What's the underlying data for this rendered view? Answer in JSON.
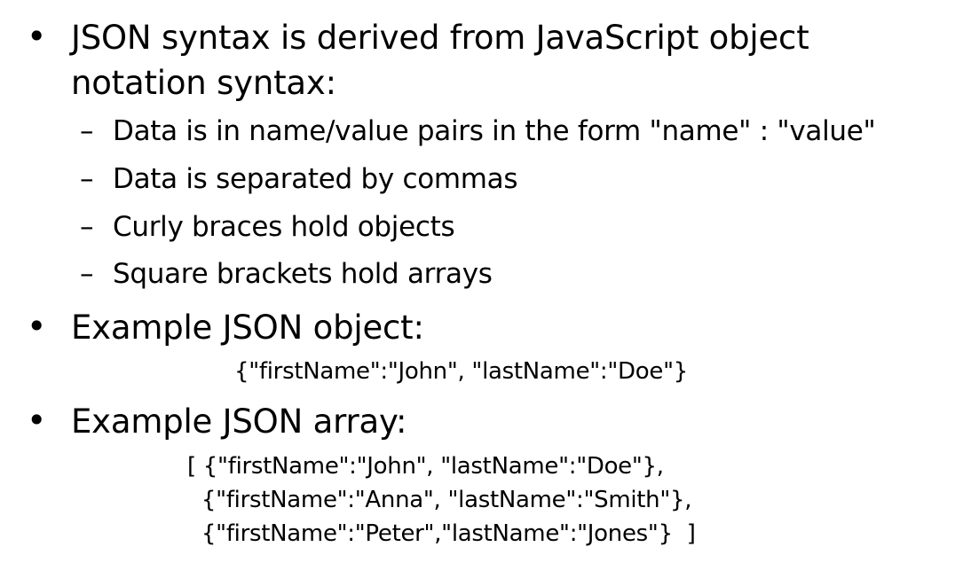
{
  "bullets": [
    {
      "text_line1": "JSON syntax is derived from JavaScript object",
      "text_line2": "notation syntax:",
      "sub_items": [
        "Data is in name/value pairs in the form \"name\" : \"value\"",
        "Data is separated by commas",
        "Curly braces hold objects",
        "Square brackets hold arrays"
      ]
    },
    {
      "text": "Example JSON object:",
      "code": "{\"firstName\":\"John\", \"lastName\":\"Doe\"}"
    },
    {
      "text": "Example JSON array:",
      "code_lines": [
        "[ {\"firstName\":\"John\", \"lastName\":\"Doe\"},",
        "  {\"firstName\":\"Anna\", \"lastName\":\"Smith\"},",
        "  {\"firstName\":\"Peter\",\"lastName\":\"Jones\"}  ]"
      ]
    }
  ],
  "symbols": {
    "bullet": "•",
    "dash": "–"
  }
}
